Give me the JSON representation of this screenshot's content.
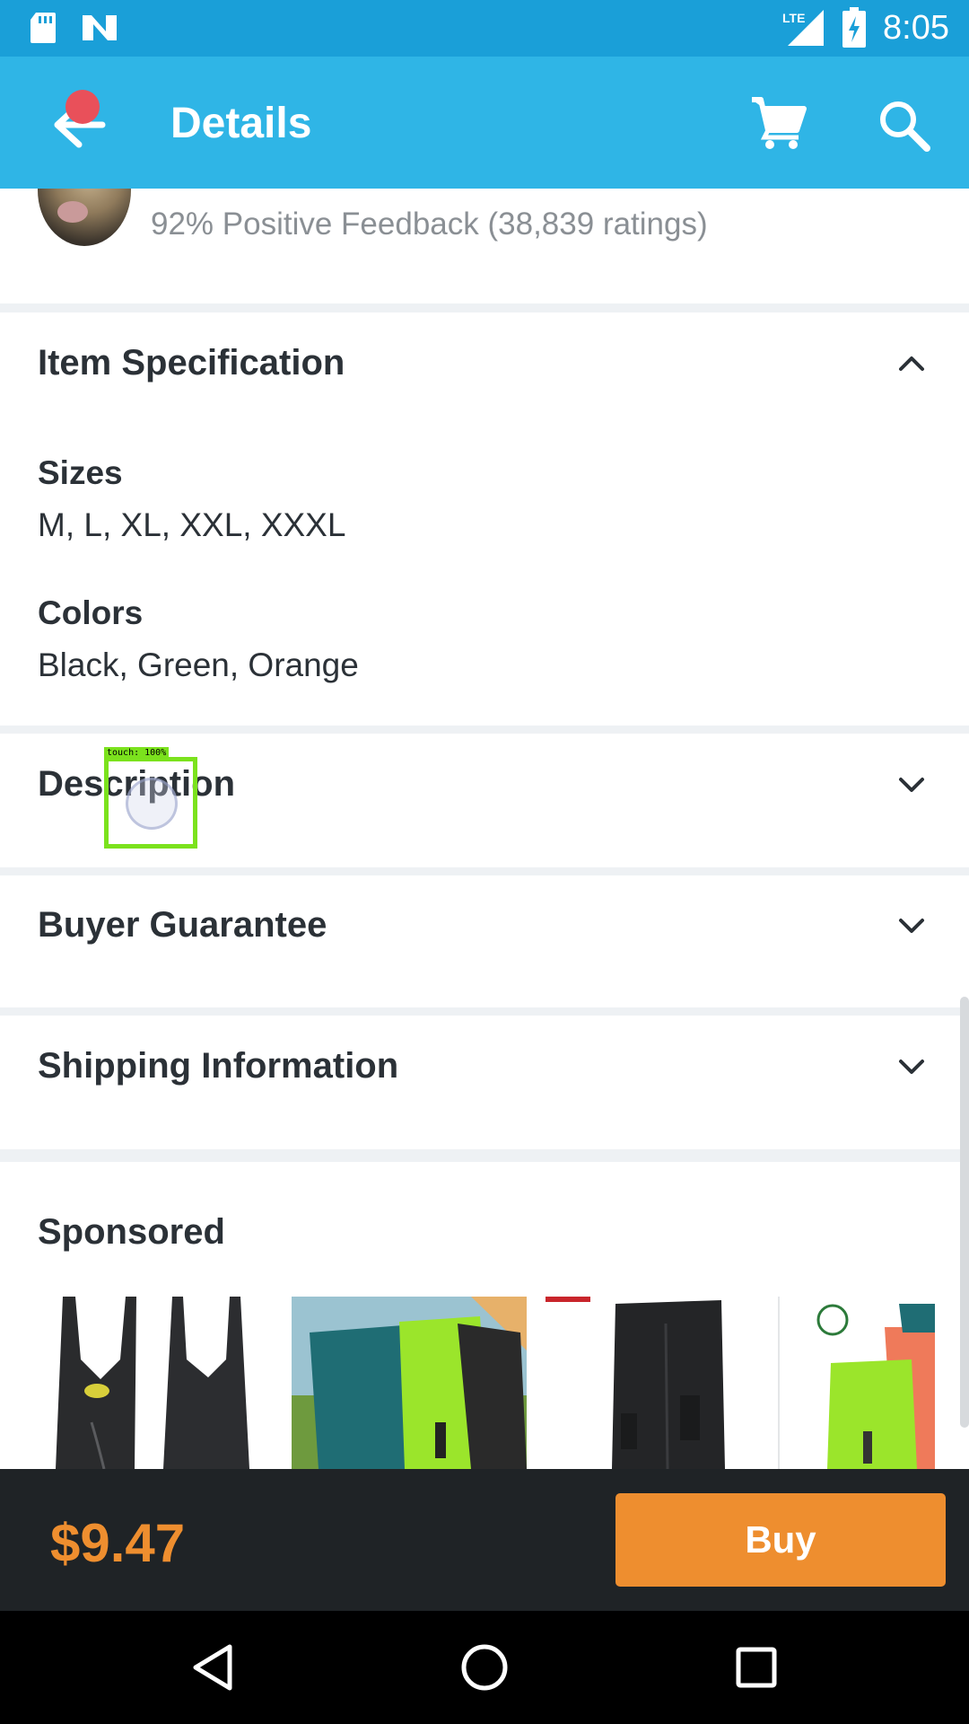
{
  "status_bar": {
    "time": "8:05",
    "network": "LTE",
    "icons": [
      "sd-card-icon",
      "n-logo-icon",
      "lte-signal-icon",
      "battery-charging-icon"
    ]
  },
  "app_bar": {
    "title": "Details",
    "icons": [
      "back-arrow-icon",
      "cart-icon",
      "search-icon"
    ],
    "accent_color": "#2fb5e6"
  },
  "seller": {
    "feedback": "92% Positive Feedback (38,839 ratings)"
  },
  "item_specification": {
    "title": "Item Specification",
    "expanded": true,
    "specs": [
      {
        "label": "Sizes",
        "value": "M, L, XL, XXL, XXXL"
      },
      {
        "label": "Colors",
        "value": "Black, Green, Orange"
      }
    ]
  },
  "sections": [
    {
      "title": "Description",
      "expanded": false
    },
    {
      "title": "Buyer Guarantee",
      "expanded": false
    },
    {
      "title": "Shipping Information",
      "expanded": false
    }
  ],
  "sponsored": {
    "title": "Sponsored",
    "products": [
      "black-bib-shorts",
      "teal-green-black-shorts",
      "black-cycling-pants",
      "green-orange-cycling-shorts"
    ]
  },
  "touch_overlay": {
    "label": "touch: 100%"
  },
  "buy_bar": {
    "price": "$9.47",
    "buy_label": "Buy",
    "price_color": "#ee8e2f"
  },
  "nav_bar": {
    "icons": [
      "back-triangle-icon",
      "home-circle-icon",
      "recents-square-icon"
    ]
  }
}
